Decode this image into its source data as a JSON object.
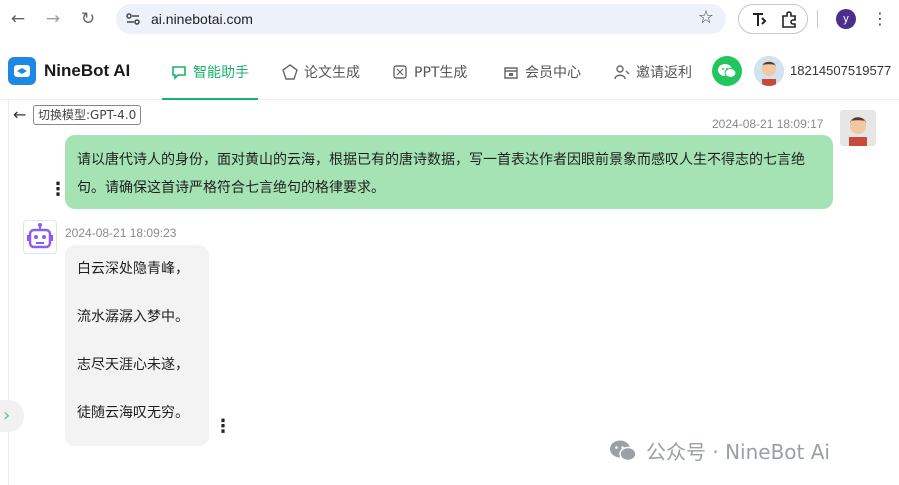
{
  "browser": {
    "url": "ai.ninebotai.com",
    "profile_initial": "y"
  },
  "app": {
    "brand": "NineBot AI",
    "tabs": [
      {
        "label": "智能助手",
        "icon": "chat-icon",
        "active": true
      },
      {
        "label": "论文生成",
        "icon": "paper-icon",
        "active": false
      },
      {
        "label": "PPT生成",
        "icon": "ppt-icon",
        "active": false
      },
      {
        "label": "会员中心",
        "icon": "member-icon",
        "active": false
      },
      {
        "label": "邀请返利",
        "icon": "invite-icon",
        "active": false
      }
    ],
    "user_phone": "18214507519577",
    "accent": "#19b26b"
  },
  "chat": {
    "model_label": "切换模型:GPT-4.0",
    "user_message": {
      "timestamp": "2024-08-21 18:09:17",
      "text": "请以唐代诗人的身份，面对黄山的云海，根据已有的唐诗数据，写一首表达作者因眼前景象而感叹人生不得志的七言绝句。请确保这首诗严格符合七言绝句的格律要求。"
    },
    "bot_message": {
      "timestamp": "2024-08-21 18:09:23",
      "lines": [
        "白云深处隐青峰，",
        "流水潺潺入梦中。",
        "志尽天涯心未遂，",
        "徒随云海叹无穷。"
      ]
    }
  },
  "watermark": "公众号 · NineBot Ai"
}
